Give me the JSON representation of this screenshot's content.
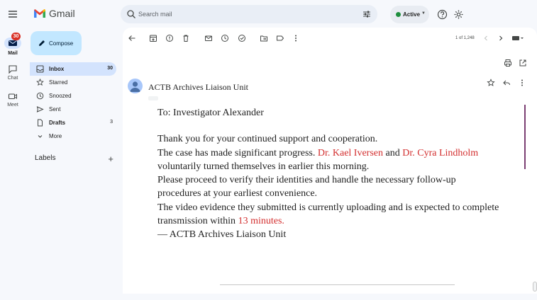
{
  "app": {
    "logo_text": "Gmail"
  },
  "rail": {
    "mail_label": "Mail",
    "mail_badge": "30",
    "chat_label": "Chat",
    "meet_label": "Meet"
  },
  "search": {
    "placeholder": "Search mail"
  },
  "status": {
    "label": "Active",
    "color": "#1e8e3e"
  },
  "compose": {
    "label": "Compose"
  },
  "nav": {
    "items": [
      {
        "label": "Inbox",
        "count": "30",
        "icon": "inbox-icon"
      },
      {
        "label": "Starred",
        "count": "",
        "icon": "star-icon"
      },
      {
        "label": "Snoozed",
        "count": "",
        "icon": "clock-icon"
      },
      {
        "label": "Sent",
        "count": "",
        "icon": "send-icon"
      },
      {
        "label": "Drafts",
        "count": "3",
        "icon": "draft-icon"
      },
      {
        "label": "More",
        "count": "",
        "icon": "chevron-down-icon"
      }
    ]
  },
  "labels": {
    "title": "Labels",
    "add": "+"
  },
  "toolbar": {
    "pager": "1 of 1,248"
  },
  "message": {
    "sender": "ACTB Archives Liaison Unit",
    "greeting": "To: Investigator Alexander",
    "line1": "Thank you for your continued support and cooperation.",
    "line2_pre": "The case has made significant progress.",
    "name1": "Dr. Kael Iversen",
    "and": "and",
    "name2": "Dr. Cyra Lindholm",
    "line3": "voluntarily turned themselves in earlier this morning.",
    "line4": "Please proceed to verify their identities and handle the necessary follow-up",
    "line5": "procedures at your earliest convenience.",
    "line6": "The video evidence they submitted is currently uploading and is expected to complete",
    "line7_pre": "transmission within",
    "minutes": "13 minutes.",
    "signature": "— ACTB Archives Liaison Unit",
    "highlight_color": "#d32f2f"
  }
}
